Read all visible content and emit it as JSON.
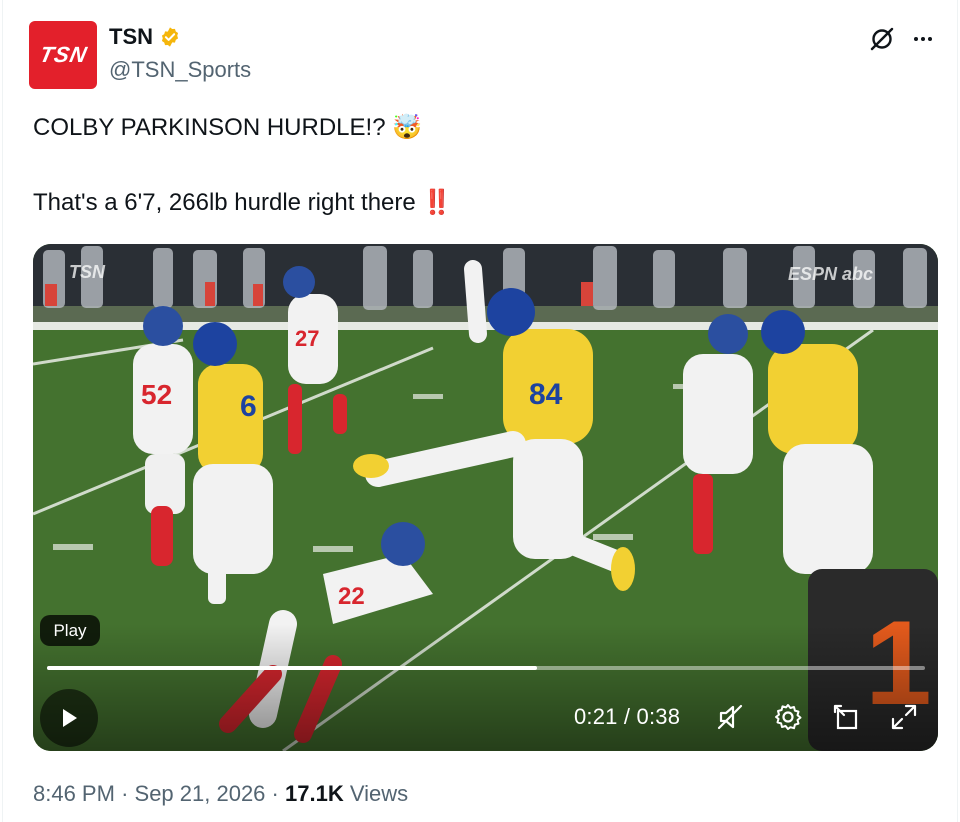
{
  "author": {
    "display_name": "TSN",
    "handle": "@TSN_Sports",
    "avatar_text": "TSN",
    "verified": true,
    "verified_color": "#f5b60c",
    "brand_color": "#e3202b"
  },
  "header_actions": {
    "grok_icon": "grok-slash-icon",
    "more_icon": "ellipsis-icon"
  },
  "tweet": {
    "line1": "COLBY PARKINSON HURDLE!? 🤯",
    "line2": "That's a 6'7, 266lb hurdle right there ‼️"
  },
  "video": {
    "overlay_label": "Play",
    "current_time": "0:21",
    "duration": "0:38",
    "time_display": "0:21 / 0:38",
    "progress": 0.558,
    "watermark_left": "TSN",
    "watermark_right": "ESPN abc",
    "controls": [
      "play-icon",
      "mute-icon",
      "settings-icon",
      "pip-icon",
      "fullscreen-icon"
    ]
  },
  "meta": {
    "time": "8:46 PM",
    "date": "Sep 21, 2026",
    "views_count": "17.1K",
    "views_label": "Views"
  }
}
